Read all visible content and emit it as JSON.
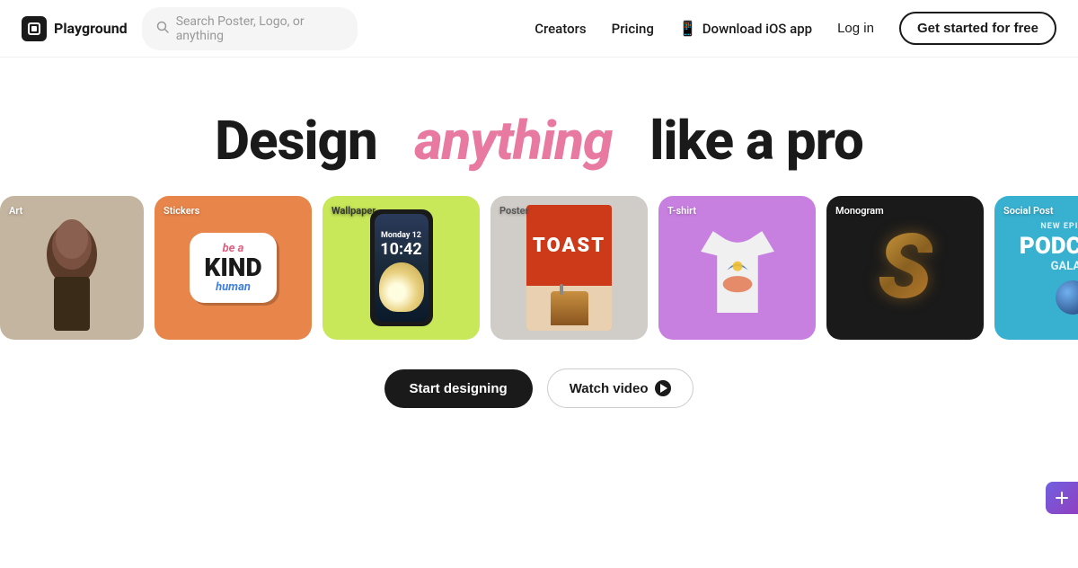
{
  "navbar": {
    "logo": "Playground",
    "search_placeholder": "Search Poster, Logo, or anything",
    "nav_creators": "Creators",
    "nav_pricing": "Pricing",
    "nav_ios": "Download iOS app",
    "nav_login": "Log in",
    "nav_cta": "Get started for free"
  },
  "hero": {
    "title_before": "Design",
    "title_highlight": "anything",
    "title_after": "like a pro"
  },
  "cards": [
    {
      "label": "Art",
      "bg": "#c4b5a0"
    },
    {
      "label": "Stickers",
      "bg": "#e8854a"
    },
    {
      "label": "Wallpaper",
      "bg": "#c8e85a"
    },
    {
      "label": "Poster",
      "bg": "#d0ccc8"
    },
    {
      "label": "T-shirt",
      "bg": "#c880e0"
    },
    {
      "label": "Monogram",
      "bg": "#1a1a1a"
    },
    {
      "label": "Social Post",
      "bg": "#38b0d0"
    }
  ],
  "cta": {
    "start": "Start designing",
    "watch": "Watch video"
  },
  "sticker": {
    "line1": "be a",
    "line2": "KIND",
    "line3": "human"
  },
  "phone": {
    "time": "10:42",
    "date": "Monday 12"
  },
  "poster": {
    "text": "TOAST"
  },
  "monogram": {
    "letter": "S"
  },
  "social": {
    "new_ep": "NEW EPISODE.",
    "title": "PODCAST",
    "subtitle": "GALAXY"
  }
}
